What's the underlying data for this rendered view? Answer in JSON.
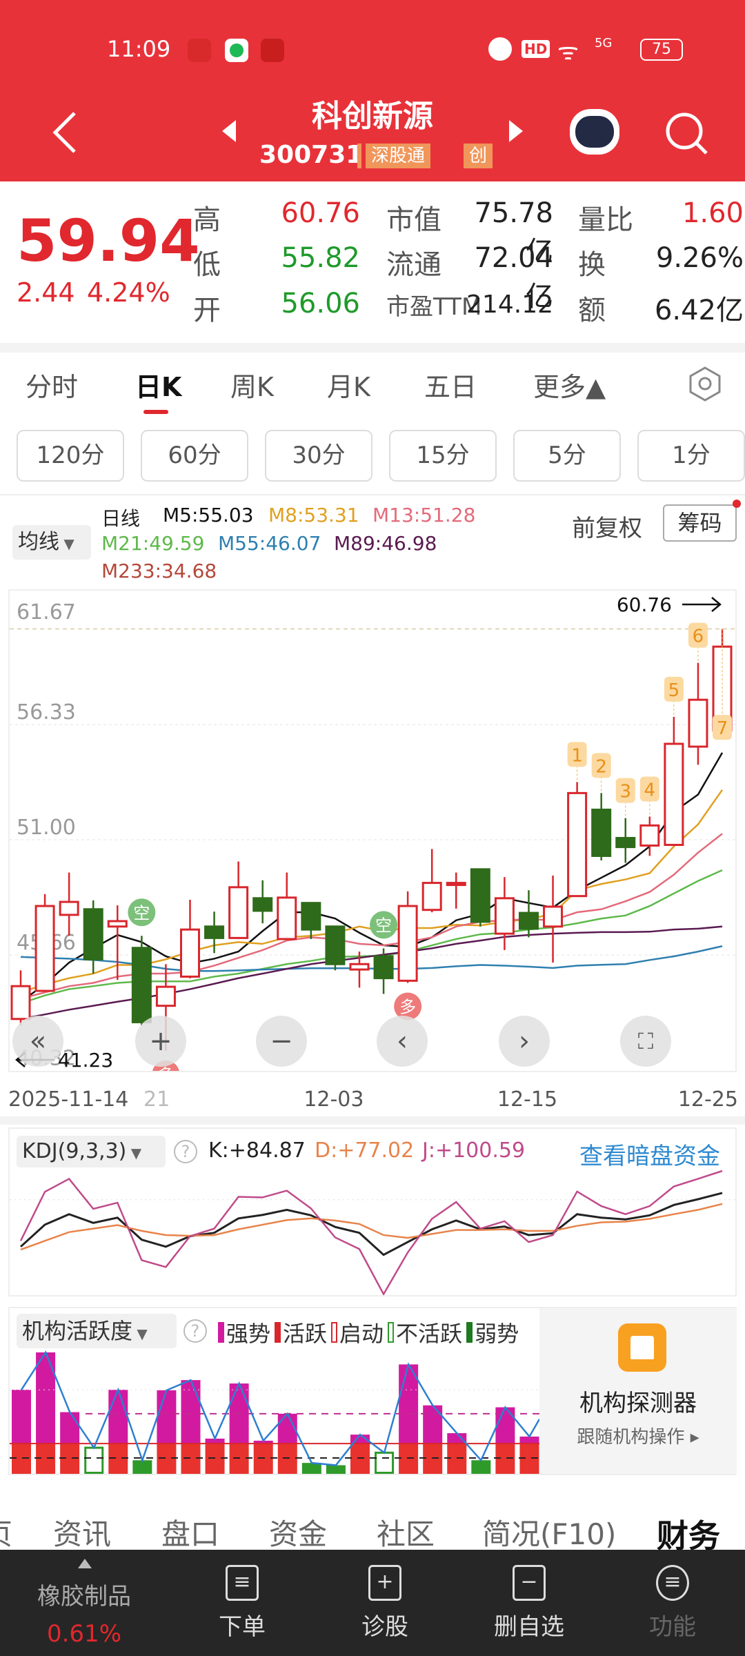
{
  "status_bar": {
    "time": "11:09",
    "battery": "75",
    "network": "5G",
    "hd": "HD"
  },
  "header": {
    "title": "科创新源",
    "code": "300731",
    "tags": [
      "深股通",
      "创"
    ]
  },
  "quote": {
    "price": "59.94",
    "change": "2.44",
    "change_pct": "4.24%",
    "rows": [
      {
        "label": "高",
        "value": "60.76",
        "color": "red",
        "label2": "市值",
        "value2": "75.78亿",
        "label3": "量比",
        "value3": "1.60",
        "color3": "red"
      },
      {
        "label": "低",
        "value": "55.82",
        "color": "green",
        "label2": "流通",
        "value2": "72.04亿",
        "label3": "换",
        "value3": "9.26%",
        "color3": "dark"
      },
      {
        "label": "开",
        "value": "56.06",
        "color": "green",
        "label2": "市盈TTM",
        "value2": "214.12",
        "label3": "额",
        "value3": "6.42亿",
        "color3": "dark"
      }
    ]
  },
  "tabs": [
    {
      "label": "分时"
    },
    {
      "label": "日K",
      "active": true
    },
    {
      "label": "周K"
    },
    {
      "label": "月K"
    },
    {
      "label": "五日"
    },
    {
      "label": "更多▲"
    }
  ],
  "intervals": [
    "120分",
    "60分",
    "30分",
    "15分",
    "5分",
    "1分"
  ],
  "legend": {
    "ma_button": "均线",
    "period": "日线",
    "items": [
      {
        "text": "M5:55.03",
        "color": "#111111"
      },
      {
        "text": "M8:53.31",
        "color": "#E0A020"
      },
      {
        "text": "M13:51.28",
        "color": "#E36A7A"
      },
      {
        "text": "M21:49.59",
        "color": "#5DB94A"
      },
      {
        "text": "M55:46.07",
        "color": "#2E7FB0"
      },
      {
        "text": "M89:46.98",
        "color": "#5A1A50"
      },
      {
        "text": "M233:34.68",
        "color": "#B5473A"
      }
    ],
    "adjust": "前复权",
    "chips": "筹码"
  },
  "chart_data": [
    {
      "type": "candlestick",
      "y_ticks": [
        "61.67",
        "56.33",
        "51.00",
        "45.66",
        "40.32"
      ],
      "ylim": [
        40.32,
        61.67
      ],
      "x_labels": [
        {
          "index": 0,
          "text": "2025-11-14"
        },
        {
          "index": 6,
          "text": "21"
        },
        {
          "index": 13,
          "text": "12-03"
        },
        {
          "index": 21,
          "text": "12-15"
        },
        {
          "index": 29,
          "text": "12-25"
        }
      ],
      "high_label": "60.76",
      "low_label": "41.23",
      "candles": [
        [
          42.7,
          44.22,
          44.95,
          42.41
        ],
        [
          44.0,
          47.93,
          48.48,
          44.0
        ],
        [
          47.52,
          48.12,
          49.48,
          46.55
        ],
        [
          47.78,
          45.46,
          48.19,
          44.8
        ],
        [
          46.98,
          47.23,
          47.96,
          44.51
        ],
        [
          45.99,
          42.55,
          46.55,
          42.4
        ],
        [
          43.31,
          44.19,
          45.24,
          41.23
        ],
        [
          44.66,
          46.84,
          48.22,
          44.58
        ],
        [
          46.98,
          46.45,
          47.67,
          45.75
        ],
        [
          46.45,
          48.8,
          49.99,
          46.4
        ],
        [
          48.29,
          47.71,
          49.12,
          47.13
        ],
        [
          46.4,
          48.32,
          49.48,
          46.36
        ],
        [
          48.07,
          46.84,
          48.07,
          46.4
        ],
        [
          46.98,
          45.24,
          46.98,
          44.95
        ],
        [
          44.99,
          45.24,
          45.82,
          44.15
        ],
        [
          45.6,
          44.59,
          45.97,
          43.86
        ],
        [
          44.47,
          47.93,
          48.61,
          44.37
        ],
        [
          47.75,
          49.0,
          50.57,
          47.64
        ],
        [
          48.95,
          49.0,
          49.48,
          47.81
        ],
        [
          49.63,
          47.2,
          49.63,
          46.98
        ],
        [
          46.65,
          48.29,
          49.27,
          45.89
        ],
        [
          47.61,
          46.88,
          48.66,
          46.48
        ],
        [
          46.98,
          47.9,
          49.34,
          45.31
        ],
        [
          48.39,
          53.16,
          53.67,
          48.39
        ],
        [
          52.39,
          50.25,
          53.16,
          50.04
        ],
        [
          51.08,
          50.66,
          52.0,
          49.93
        ],
        [
          50.73,
          51.66,
          52.07,
          50.25
        ],
        [
          50.76,
          55.44,
          56.69,
          50.76
        ],
        [
          55.31,
          57.48,
          59.19,
          54.47
        ],
        [
          56.06,
          59.94,
          60.76,
          55.82
        ]
      ],
      "ma": [
        {
          "name": "M5",
          "color": "#111111",
          "values": [
            43.5,
            44.3,
            45.31,
            45.97,
            46.59,
            46.26,
            45.6,
            45.28,
            45.49,
            45.82,
            46.77,
            47.64,
            47.64,
            47.35,
            46.69,
            46.11,
            46.04,
            46.48,
            47.27,
            47.57,
            48.29,
            48.07,
            47.86,
            48.66,
            49.24,
            49.82,
            50.69,
            52.29,
            53.09,
            55.03
          ]
        },
        {
          "name": "M8",
          "color": "#E0A020",
          "values": [
            43.93,
            44.3,
            44.59,
            44.8,
            45.2,
            45.2,
            45.46,
            45.82,
            46.11,
            46.26,
            46.18,
            46.48,
            46.55,
            46.69,
            46.98,
            46.77,
            46.91,
            46.91,
            47.06,
            47.03,
            47.2,
            47.32,
            47.57,
            48.66,
            48.95,
            49.16,
            49.45,
            50.69,
            51.71,
            53.31
          ]
        },
        {
          "name": "M13",
          "color": "#E36A7A",
          "values": [
            43.64,
            43.93,
            44.22,
            44.37,
            44.66,
            44.8,
            44.8,
            44.88,
            45.17,
            45.53,
            45.89,
            46.33,
            46.48,
            46.4,
            46.18,
            46.11,
            46.26,
            46.48,
            46.98,
            47.2,
            47.27,
            47.32,
            47.27,
            47.64,
            47.78,
            48.15,
            48.58,
            49.38,
            50.4,
            51.28
          ]
        },
        {
          "name": "M21",
          "color": "#5DB94A",
          "values": [
            43.42,
            43.79,
            44.08,
            44.22,
            44.37,
            44.44,
            44.44,
            44.44,
            44.66,
            44.8,
            45.02,
            45.24,
            45.39,
            45.57,
            45.6,
            45.63,
            45.82,
            46.11,
            46.4,
            46.62,
            46.69,
            46.84,
            46.94,
            47.13,
            47.35,
            47.49,
            47.93,
            48.51,
            49.09,
            49.59
          ]
        },
        {
          "name": "M55",
          "color": "#2E7FB0",
          "values": [
            45.57,
            45.53,
            45.49,
            45.43,
            45.34,
            45.2,
            45.02,
            44.92,
            44.92,
            44.95,
            44.99,
            45.02,
            45.05,
            45.05,
            45.05,
            45.02,
            45.02,
            45.06,
            45.14,
            45.2,
            45.17,
            45.12,
            45.06,
            45.17,
            45.21,
            45.24,
            45.43,
            45.6,
            45.82,
            46.07
          ]
        },
        {
          "name": "M89",
          "color": "#5A1A50",
          "values": [
            42.7,
            42.91,
            43.13,
            43.31,
            43.5,
            43.67,
            43.86,
            44.08,
            44.33,
            44.59,
            44.8,
            45.02,
            45.24,
            45.39,
            45.53,
            45.68,
            45.82,
            45.97,
            46.18,
            46.33,
            46.5,
            46.59,
            46.65,
            46.69,
            46.72,
            46.72,
            46.74,
            46.84,
            46.88,
            46.98
          ]
        }
      ],
      "signals": [
        {
          "index": 5,
          "text": "空",
          "type": "sell"
        },
        {
          "index": 15,
          "text": "空",
          "type": "sell"
        },
        {
          "index": 16,
          "text": "多",
          "type": "buy"
        },
        {
          "index": 6,
          "text": "多",
          "type": "buy"
        }
      ],
      "numbered": [
        {
          "index": 23,
          "text": "1"
        },
        {
          "index": 24,
          "text": "2"
        },
        {
          "index": 25,
          "text": "3"
        },
        {
          "index": 26,
          "text": "4"
        },
        {
          "index": 27,
          "text": "5"
        },
        {
          "index": 28,
          "text": "6"
        },
        {
          "index": 29,
          "text": "7"
        }
      ]
    },
    {
      "type": "line",
      "title": "KDJ(9,3,3)",
      "labels": {
        "k": "K:+84.87",
        "d": "D:+77.02",
        "j": "J:+100.59"
      },
      "series": [
        {
          "name": "K",
          "color": "#222222",
          "values": [
            46.5,
            62.2,
            69.7,
            63.5,
            67.2,
            51.5,
            46.5,
            54.0,
            56.4,
            66.7,
            69.2,
            72.8,
            68.9,
            60.6,
            56.4,
            40.7,
            49.8,
            58.9,
            65.2,
            58.9,
            60.9,
            54.8,
            56.1,
            69.7,
            67.2,
            66.0,
            68.9,
            76.3,
            80.4,
            84.87
          ]
        },
        {
          "name": "D",
          "color": "#E8834A",
          "values": [
            44.4,
            50.7,
            56.9,
            59.4,
            61.9,
            57.8,
            54.8,
            54.3,
            54.8,
            58.9,
            62.2,
            65.5,
            66.7,
            65.2,
            62.7,
            54.8,
            52.8,
            55.6,
            58.4,
            58.4,
            58.9,
            57.8,
            57.8,
            61.4,
            63.9,
            64.4,
            66.4,
            69.7,
            72.8,
            77.02
          ]
        },
        {
          "name": "J",
          "color": "#C04A8A",
          "values": [
            50.7,
            85.7,
            94.97,
            73.5,
            77.9,
            36.9,
            31.98,
            54.0,
            59.4,
            82.1,
            81.7,
            86.5,
            73.8,
            53.1,
            44.8,
            12.6,
            42.4,
            66.4,
            78.4,
            59.4,
            64.7,
            49.8,
            54.8,
            85.9,
            75.5,
            69.7,
            75.5,
            89.5,
            94.97,
            100.59
          ]
        }
      ],
      "link": "查看暗盘资金"
    },
    {
      "type": "bar",
      "title": "机构活跃度",
      "legend": [
        {
          "text": "强势",
          "color": "#D21AA0"
        },
        {
          "text": "活跃",
          "color": "#D8262C"
        },
        {
          "text": "启动",
          "color": "#D8262C",
          "hollow": true
        },
        {
          "text": "不活跃",
          "color": "#2E9A2A",
          "hollow": true
        },
        {
          "text": "弱势",
          "color": "#1E7A1E"
        }
      ],
      "values": [
        69.2,
        100,
        50.8,
        21.5,
        69.2,
        11.2,
        68.8,
        77.2,
        29.0,
        74.4,
        27.3,
        49.5,
        9.0,
        7.1,
        32.3,
        17.4,
        90.1,
        56.4,
        33.5,
        11.2,
        54.8,
        30.7
      ],
      "kinds": [
        "strong",
        "strong",
        "strong",
        "inactive",
        "strong",
        "weak",
        "strong",
        "strong",
        "strong",
        "strong",
        "strong",
        "strong",
        "weak",
        "weak",
        "strong",
        "inactive",
        "strong",
        "strong",
        "strong",
        "weak",
        "strong",
        "strong"
      ],
      "thresholds": {
        "active": 24.9,
        "low": 13.1,
        "mid": 49.5,
        "high": 69.2
      },
      "ylim": [
        0,
        100
      ]
    }
  ],
  "detector": {
    "title": "机构探测器",
    "subtitle": "跟随机构操作 ▸"
  },
  "bottom_tabs": [
    "页",
    "资讯",
    "盘口",
    "资金",
    "社区",
    "简况(F10)",
    "财务"
  ],
  "dock": {
    "sector": "橡胶制品",
    "sector_change": "0.61%",
    "items": [
      "下单",
      "诊股",
      "删自选",
      "功能"
    ]
  }
}
